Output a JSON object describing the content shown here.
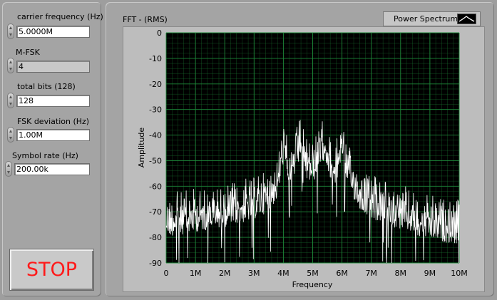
{
  "controls": {
    "carrier_frequency": {
      "label": "carrier frequency (Hz)",
      "value": "5.0000M"
    },
    "mfsk": {
      "label": "M-FSK",
      "value": "4"
    },
    "total_bits": {
      "label": "total bits (128)",
      "value": "128"
    },
    "fsk_deviation": {
      "label": "FSK deviation (Hz)",
      "value": "1.00M"
    },
    "symbol_rate": {
      "label": "Symbol rate (Hz)",
      "value": "200.00k"
    }
  },
  "stop_label": "STOP",
  "graph": {
    "title": "FFT - (RMS)",
    "legend_label": "Power Spectrum"
  },
  "chart_data": {
    "type": "line",
    "xlabel": "Frequency",
    "ylabel": "Amplitude",
    "xlim": [
      0,
      10000000
    ],
    "ylim": [
      -90,
      0
    ],
    "x_ticks": [
      "0",
      "1M",
      "2M",
      "3M",
      "4M",
      "5M",
      "6M",
      "7M",
      "8M",
      "9M",
      "10M"
    ],
    "y_ticks": [
      "0",
      "-10",
      "-20",
      "-30",
      "-40",
      "-50",
      "-60",
      "-70",
      "-80",
      "-90"
    ],
    "grid": true,
    "background": "#000000",
    "grid_color": "#1e8a3a",
    "series": [
      {
        "color": "#ffffff",
        "x": [
          0,
          500000,
          1000000,
          1500000,
          2000000,
          2500000,
          3000000,
          3500000,
          3800000,
          4000000,
          4200000,
          4400000,
          4600000,
          4800000,
          5000000,
          5200000,
          5400000,
          5600000,
          5800000,
          6000000,
          6200000,
          6400000,
          6600000,
          7000000,
          7500000,
          8000000,
          8500000,
          9000000,
          9500000,
          10000000
        ],
        "values": [
          -62,
          -61,
          -60,
          -59,
          -58,
          -57,
          -55,
          -52,
          -47,
          -33,
          -42,
          -38,
          -30,
          -40,
          -41,
          -37,
          -31,
          -39,
          -42,
          -30,
          -43,
          -47,
          -51,
          -55,
          -57,
          -59,
          -61,
          -63,
          -64,
          -65
        ]
      }
    ]
  }
}
